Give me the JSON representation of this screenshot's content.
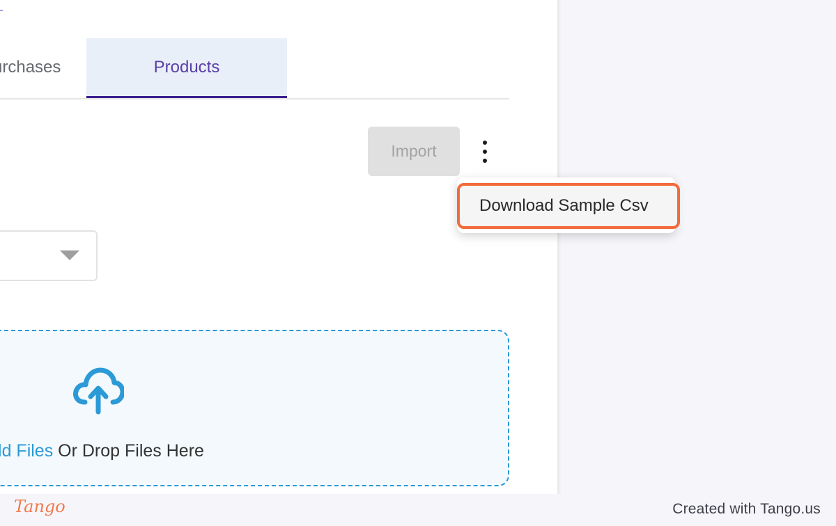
{
  "tabs": {
    "previous_label": "Purchases",
    "active_label": "Products"
  },
  "toolbar": {
    "import_label": "Import",
    "more_menu_icon": "kebab-vertical-icon"
  },
  "menu": {
    "items": [
      {
        "label": "Download Sample Csv"
      }
    ]
  },
  "select": {
    "value": "",
    "icon": "caret-down-icon"
  },
  "upload": {
    "icon": "cloud-upload-icon",
    "add_files_link": "Add Files",
    "drop_text": " Or Drop Files Here"
  },
  "colors": {
    "accent": "#2b9ad6",
    "tab_active": "#3b1d8f",
    "highlight": "#f36b3b"
  },
  "footer": {
    "logo": "Tango",
    "credit": "Created with Tango.us"
  }
}
